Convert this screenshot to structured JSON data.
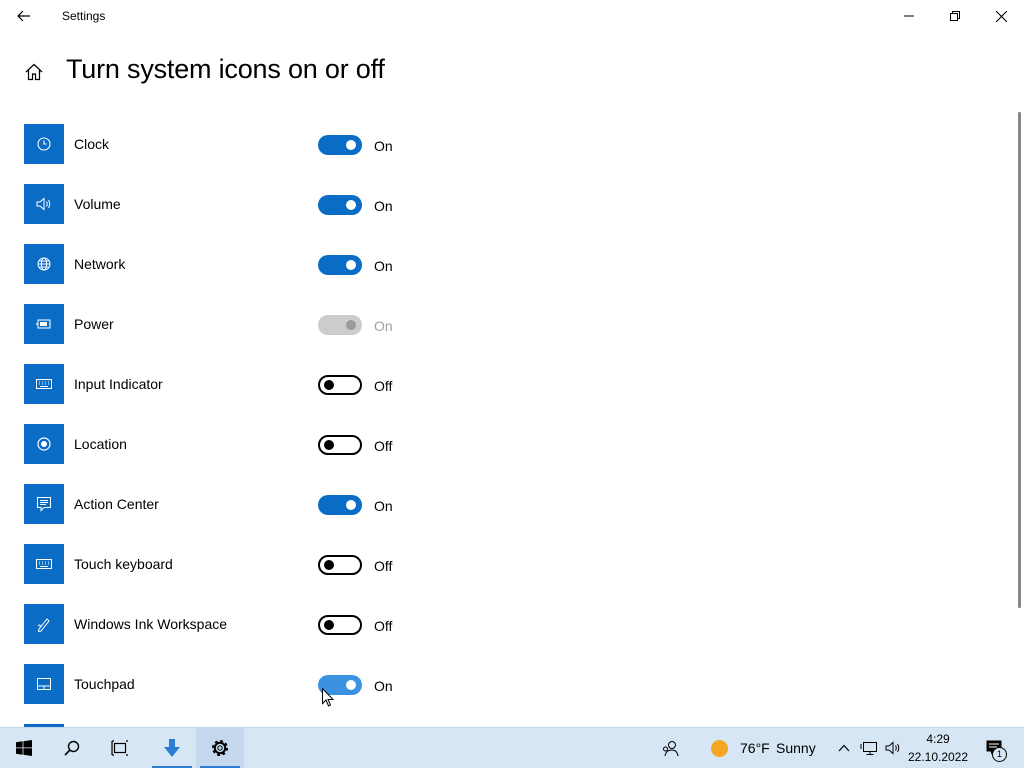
{
  "window": {
    "title": "Settings"
  },
  "page": {
    "title": "Turn system icons on or off"
  },
  "colors": {
    "accent": "#0a6cc4",
    "taskbar": "#d7e6f4",
    "weather_sun": "#f5a623"
  },
  "items": [
    {
      "label": "Clock",
      "icon": "clock-icon",
      "state": "On",
      "toggle": "on"
    },
    {
      "label": "Volume",
      "icon": "volume-icon",
      "state": "On",
      "toggle": "on"
    },
    {
      "label": "Network",
      "icon": "network-globe-icon",
      "state": "On",
      "toggle": "on"
    },
    {
      "label": "Power",
      "icon": "power-battery-icon",
      "state": "On",
      "toggle": "disabled"
    },
    {
      "label": "Input Indicator",
      "icon": "keyboard-icon",
      "state": "Off",
      "toggle": "off"
    },
    {
      "label": "Location",
      "icon": "location-icon",
      "state": "Off",
      "toggle": "off"
    },
    {
      "label": "Action Center",
      "icon": "action-center-icon",
      "state": "On",
      "toggle": "on"
    },
    {
      "label": "Touch keyboard",
      "icon": "touch-keyboard-icon",
      "state": "Off",
      "toggle": "off"
    },
    {
      "label": "Windows Ink Workspace",
      "icon": "ink-pen-icon",
      "state": "Off",
      "toggle": "off"
    },
    {
      "label": "Touchpad",
      "icon": "touchpad-icon",
      "state": "On",
      "toggle": "hover"
    }
  ],
  "taskbar": {
    "weather": {
      "temp": "76°F",
      "condition": "Sunny"
    },
    "clock": {
      "time": "4:29",
      "date": "22.10.2022"
    },
    "notification_count": "1"
  }
}
